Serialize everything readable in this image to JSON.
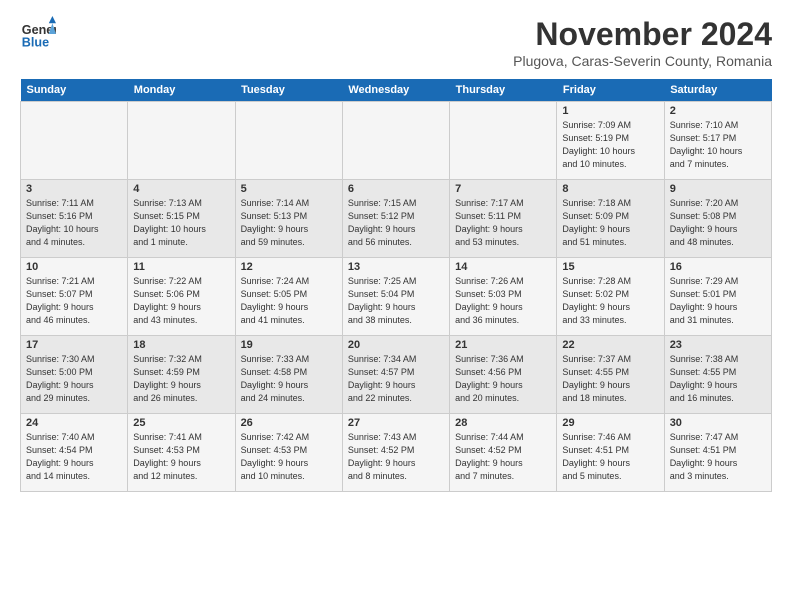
{
  "header": {
    "logo_line1": "General",
    "logo_line2": "Blue",
    "month": "November 2024",
    "location": "Plugova, Caras-Severin County, Romania"
  },
  "weekdays": [
    "Sunday",
    "Monday",
    "Tuesday",
    "Wednesday",
    "Thursday",
    "Friday",
    "Saturday"
  ],
  "weeks": [
    [
      {
        "day": "",
        "info": ""
      },
      {
        "day": "",
        "info": ""
      },
      {
        "day": "",
        "info": ""
      },
      {
        "day": "",
        "info": ""
      },
      {
        "day": "",
        "info": ""
      },
      {
        "day": "1",
        "info": "Sunrise: 7:09 AM\nSunset: 5:19 PM\nDaylight: 10 hours\nand 10 minutes."
      },
      {
        "day": "2",
        "info": "Sunrise: 7:10 AM\nSunset: 5:17 PM\nDaylight: 10 hours\nand 7 minutes."
      }
    ],
    [
      {
        "day": "3",
        "info": "Sunrise: 7:11 AM\nSunset: 5:16 PM\nDaylight: 10 hours\nand 4 minutes."
      },
      {
        "day": "4",
        "info": "Sunrise: 7:13 AM\nSunset: 5:15 PM\nDaylight: 10 hours\nand 1 minute."
      },
      {
        "day": "5",
        "info": "Sunrise: 7:14 AM\nSunset: 5:13 PM\nDaylight: 9 hours\nand 59 minutes."
      },
      {
        "day": "6",
        "info": "Sunrise: 7:15 AM\nSunset: 5:12 PM\nDaylight: 9 hours\nand 56 minutes."
      },
      {
        "day": "7",
        "info": "Sunrise: 7:17 AM\nSunset: 5:11 PM\nDaylight: 9 hours\nand 53 minutes."
      },
      {
        "day": "8",
        "info": "Sunrise: 7:18 AM\nSunset: 5:09 PM\nDaylight: 9 hours\nand 51 minutes."
      },
      {
        "day": "9",
        "info": "Sunrise: 7:20 AM\nSunset: 5:08 PM\nDaylight: 9 hours\nand 48 minutes."
      }
    ],
    [
      {
        "day": "10",
        "info": "Sunrise: 7:21 AM\nSunset: 5:07 PM\nDaylight: 9 hours\nand 46 minutes."
      },
      {
        "day": "11",
        "info": "Sunrise: 7:22 AM\nSunset: 5:06 PM\nDaylight: 9 hours\nand 43 minutes."
      },
      {
        "day": "12",
        "info": "Sunrise: 7:24 AM\nSunset: 5:05 PM\nDaylight: 9 hours\nand 41 minutes."
      },
      {
        "day": "13",
        "info": "Sunrise: 7:25 AM\nSunset: 5:04 PM\nDaylight: 9 hours\nand 38 minutes."
      },
      {
        "day": "14",
        "info": "Sunrise: 7:26 AM\nSunset: 5:03 PM\nDaylight: 9 hours\nand 36 minutes."
      },
      {
        "day": "15",
        "info": "Sunrise: 7:28 AM\nSunset: 5:02 PM\nDaylight: 9 hours\nand 33 minutes."
      },
      {
        "day": "16",
        "info": "Sunrise: 7:29 AM\nSunset: 5:01 PM\nDaylight: 9 hours\nand 31 minutes."
      }
    ],
    [
      {
        "day": "17",
        "info": "Sunrise: 7:30 AM\nSunset: 5:00 PM\nDaylight: 9 hours\nand 29 minutes."
      },
      {
        "day": "18",
        "info": "Sunrise: 7:32 AM\nSunset: 4:59 PM\nDaylight: 9 hours\nand 26 minutes."
      },
      {
        "day": "19",
        "info": "Sunrise: 7:33 AM\nSunset: 4:58 PM\nDaylight: 9 hours\nand 24 minutes."
      },
      {
        "day": "20",
        "info": "Sunrise: 7:34 AM\nSunset: 4:57 PM\nDaylight: 9 hours\nand 22 minutes."
      },
      {
        "day": "21",
        "info": "Sunrise: 7:36 AM\nSunset: 4:56 PM\nDaylight: 9 hours\nand 20 minutes."
      },
      {
        "day": "22",
        "info": "Sunrise: 7:37 AM\nSunset: 4:55 PM\nDaylight: 9 hours\nand 18 minutes."
      },
      {
        "day": "23",
        "info": "Sunrise: 7:38 AM\nSunset: 4:55 PM\nDaylight: 9 hours\nand 16 minutes."
      }
    ],
    [
      {
        "day": "24",
        "info": "Sunrise: 7:40 AM\nSunset: 4:54 PM\nDaylight: 9 hours\nand 14 minutes."
      },
      {
        "day": "25",
        "info": "Sunrise: 7:41 AM\nSunset: 4:53 PM\nDaylight: 9 hours\nand 12 minutes."
      },
      {
        "day": "26",
        "info": "Sunrise: 7:42 AM\nSunset: 4:53 PM\nDaylight: 9 hours\nand 10 minutes."
      },
      {
        "day": "27",
        "info": "Sunrise: 7:43 AM\nSunset: 4:52 PM\nDaylight: 9 hours\nand 8 minutes."
      },
      {
        "day": "28",
        "info": "Sunrise: 7:44 AM\nSunset: 4:52 PM\nDaylight: 9 hours\nand 7 minutes."
      },
      {
        "day": "29",
        "info": "Sunrise: 7:46 AM\nSunset: 4:51 PM\nDaylight: 9 hours\nand 5 minutes."
      },
      {
        "day": "30",
        "info": "Sunrise: 7:47 AM\nSunset: 4:51 PM\nDaylight: 9 hours\nand 3 minutes."
      }
    ]
  ]
}
